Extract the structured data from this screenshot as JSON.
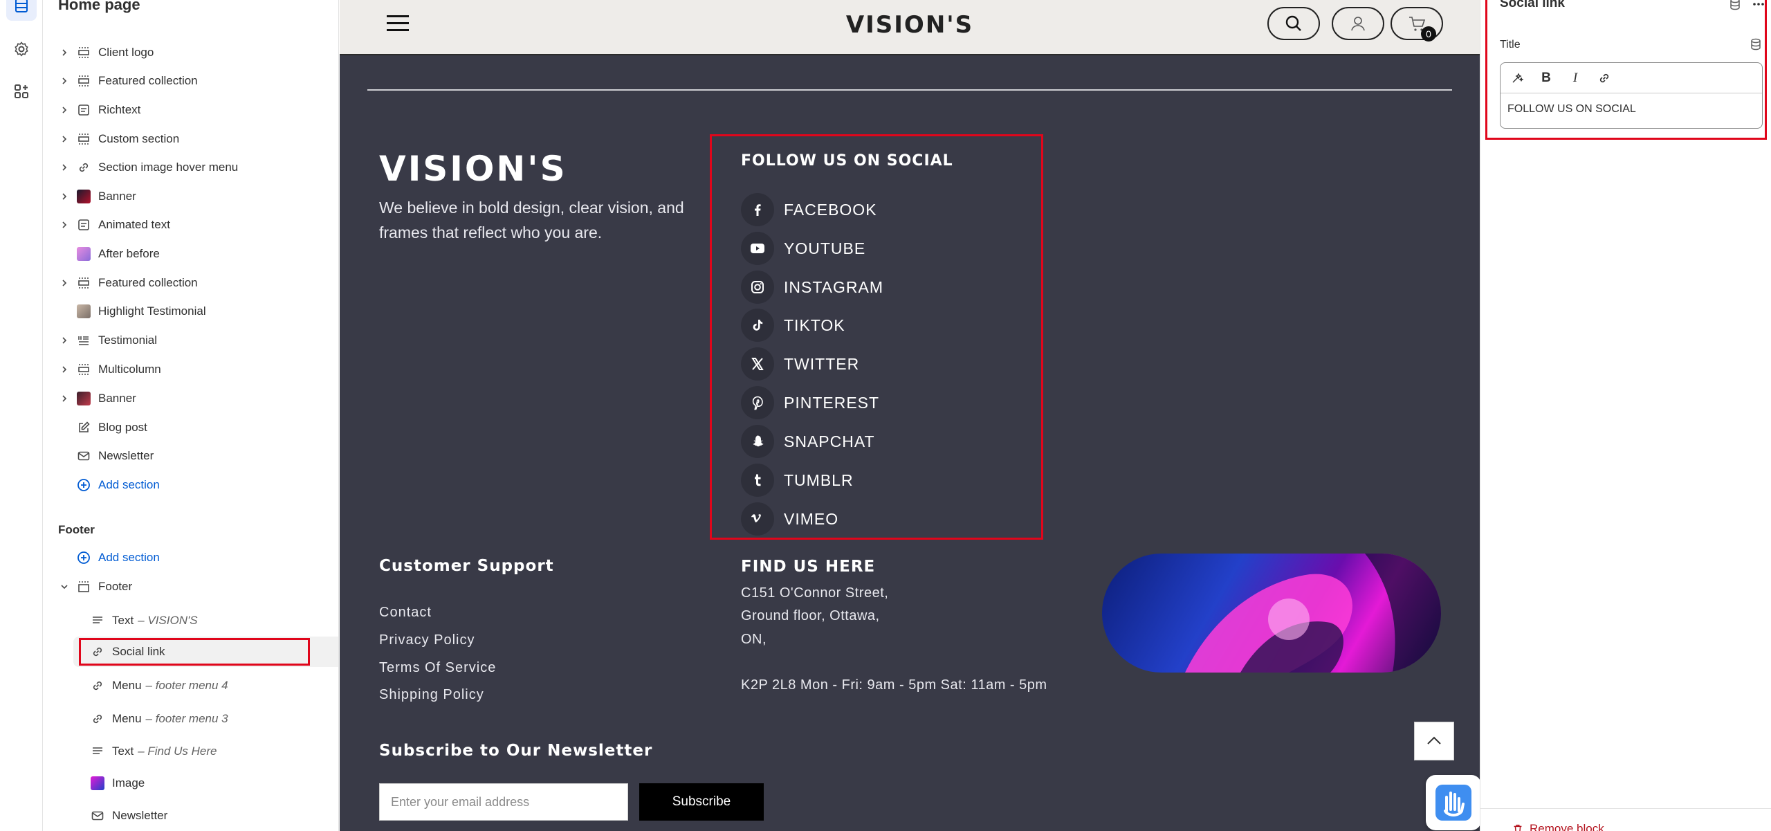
{
  "sidebar": {
    "title": "Home page",
    "sections": [
      {
        "label": "Client logo",
        "icon": "section-icon"
      },
      {
        "label": "Featured collection",
        "icon": "section-icon"
      },
      {
        "label": "Richtext",
        "icon": "text-block-icon"
      },
      {
        "label": "Custom section",
        "icon": "section-icon"
      },
      {
        "label": "Section image hover menu",
        "icon": "link-icon"
      },
      {
        "label": "Banner",
        "icon": "image-thumb"
      },
      {
        "label": "Animated text",
        "icon": "text-block-icon"
      },
      {
        "label": "After before",
        "icon": "image-thumb"
      },
      {
        "label": "Featured collection",
        "icon": "section-icon"
      },
      {
        "label": "Highlight Testimonial",
        "icon": "image-thumb"
      },
      {
        "label": "Testimonial",
        "icon": "list-icon"
      },
      {
        "label": "Multicolumn",
        "icon": "section-icon"
      },
      {
        "label": "Banner",
        "icon": "image-thumb"
      },
      {
        "label": "Blog post",
        "icon": "edit-icon"
      },
      {
        "label": "Newsletter",
        "icon": "mail-icon"
      }
    ],
    "add_section": "Add section",
    "footer_group": "Footer",
    "footer_add_section": "Add section",
    "footer_section": "Footer",
    "footer_blocks": [
      {
        "label": "Text",
        "sub": "– VISION'S",
        "icon": "text-icon"
      },
      {
        "label": "Social link",
        "sub": "",
        "icon": "link-icon"
      },
      {
        "label": "Menu",
        "sub": "– footer menu 4",
        "icon": "link-icon"
      },
      {
        "label": "Menu",
        "sub": "– footer menu 3",
        "icon": "link-icon"
      },
      {
        "label": "Text",
        "sub": "– Find Us Here",
        "icon": "text-icon"
      },
      {
        "label": "Image",
        "sub": "",
        "icon": "image-thumb"
      },
      {
        "label": "Newsletter",
        "sub": "",
        "icon": "mail-icon"
      }
    ]
  },
  "preview": {
    "logo": "VISION'S",
    "cart_count": "0",
    "brand": "VISION'S",
    "tagline": "We believe in bold design, clear vision, and frames that reflect who you are.",
    "social_title": "FOLLOW US ON SOCIAL",
    "social_links": [
      {
        "label": "FACEBOOK",
        "icon": "facebook-icon"
      },
      {
        "label": "YOUTUBE",
        "icon": "youtube-icon"
      },
      {
        "label": "INSTAGRAM",
        "icon": "instagram-icon"
      },
      {
        "label": "TIKTOK",
        "icon": "tiktok-icon"
      },
      {
        "label": "TWITTER",
        "icon": "x-icon"
      },
      {
        "label": "PINTEREST",
        "icon": "pinterest-icon"
      },
      {
        "label": "SNAPCHAT",
        "icon": "snapchat-icon"
      },
      {
        "label": "TUMBLR",
        "icon": "tumblr-icon"
      },
      {
        "label": "VIMEO",
        "icon": "vimeo-icon"
      }
    ],
    "customer_support_title": "Customer Support",
    "support_links": [
      "Contact",
      "Privacy Policy",
      "Terms Of Service",
      "Shipping Policy"
    ],
    "find_us_title": "FIND US HERE",
    "address_lines": [
      "C151 O'Connor Street,",
      "Ground floor, Ottawa,",
      "ON,",
      "",
      "K2P 2L8 Mon - Fri: 9am - 5pm Sat: 11am - 5pm"
    ],
    "newsletter_title": "Subscribe to Our Newsletter",
    "email_placeholder": "Enter your email address",
    "subscribe_label": "Subscribe"
  },
  "right_panel": {
    "title": "Social link",
    "field_label": "Title",
    "field_value": "FOLLOW US ON SOCIAL",
    "toolbar": [
      "B",
      "I"
    ],
    "remove_label": "Remove block"
  },
  "colors": {
    "accent": "#005bd3",
    "highlight_red": "#e0061b",
    "footer_bg": "#393a47",
    "header_bg": "#eeece9"
  }
}
